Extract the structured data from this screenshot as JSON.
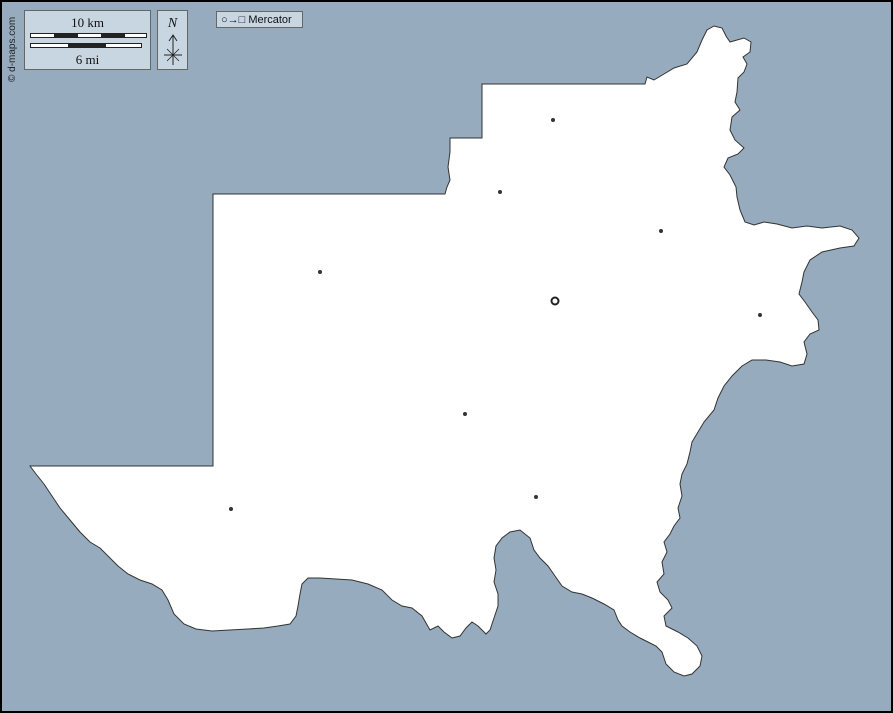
{
  "credit": "© d-maps.com",
  "scale": {
    "metric_label": "10 km",
    "imperial_label": "6 mi"
  },
  "north": {
    "label": "N"
  },
  "projection": {
    "symbol_from": "○",
    "arrow": "→",
    "symbol_to": "□",
    "name": "Mercator"
  },
  "colors": {
    "water": "#96abbd",
    "land": "#ffffff",
    "border": "#333333",
    "panel": "#c8d6e2"
  },
  "map": {
    "region_count": 1,
    "capital": {
      "symbol": "ring"
    },
    "towns": {
      "symbol": "dot",
      "count": 9
    }
  }
}
